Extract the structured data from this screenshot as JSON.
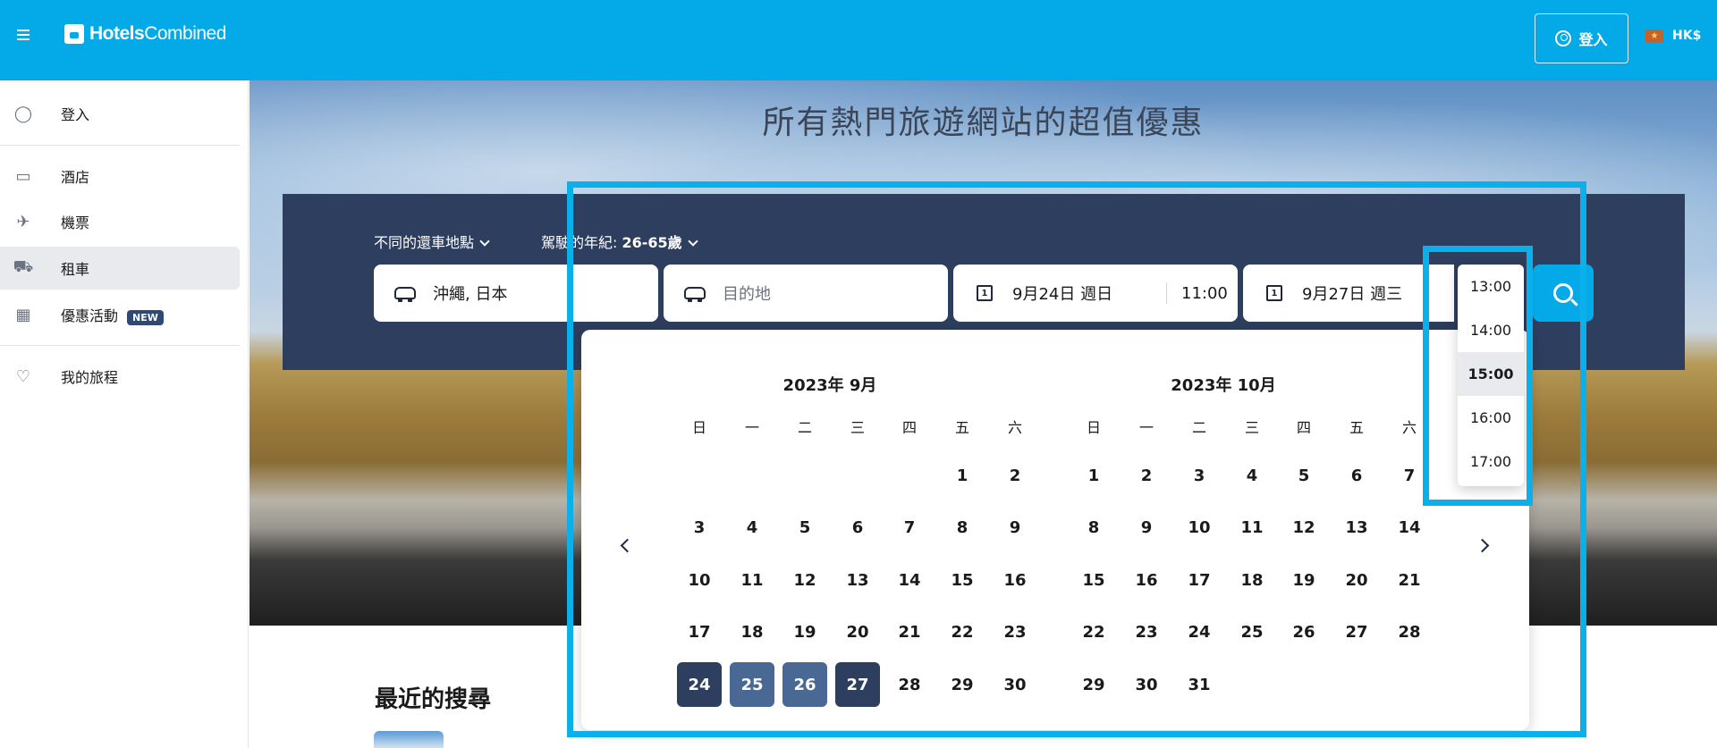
{
  "header": {
    "logo_bold": "Hotels",
    "logo_light": "Combined",
    "signin_label": "登入",
    "currency": "HK$",
    "brand_color": "#04a9e8"
  },
  "sidebar": {
    "items": [
      {
        "label": "登入",
        "icon": "user-icon"
      },
      {
        "label": "酒店",
        "icon": "bed-icon"
      },
      {
        "label": "機票",
        "icon": "plane-icon"
      },
      {
        "label": "租車",
        "icon": "car-icon"
      },
      {
        "label": "優惠活動",
        "icon": "calendar-star-icon",
        "badge": "NEW"
      },
      {
        "label": "我的旅程",
        "icon": "heart-icon"
      }
    ],
    "active": "租車"
  },
  "hero": {
    "title": "所有熱門旅遊網站的超值優惠"
  },
  "search": {
    "filters": {
      "return_location_label": "不同的還車地點",
      "driver_age_label": "駕駛的年紀: ",
      "driver_age_value": "26-65歲"
    },
    "pickup_location": "沖繩, 日本",
    "destination_placeholder": "目的地",
    "pickup_date": "9月24日 週日",
    "pickup_time": "11:00",
    "dropoff_date": "9月27日 週三",
    "cal_icon_digit": "1",
    "panel_color": "#2d3e5e"
  },
  "calendar": {
    "months": [
      {
        "title": "2023年 9月"
      },
      {
        "title": "2023年 10月"
      }
    ],
    "weekdays": [
      "日",
      "一",
      "二",
      "三",
      "四",
      "五",
      "六"
    ],
    "selected_range": [
      "9月24日",
      "9月27日"
    ]
  },
  "time_dropdown": {
    "options": [
      "13:00",
      "14:00",
      "15:00",
      "16:00",
      "17:00"
    ],
    "selected": "15:00"
  },
  "recent": {
    "title": "最近的搜尋"
  }
}
